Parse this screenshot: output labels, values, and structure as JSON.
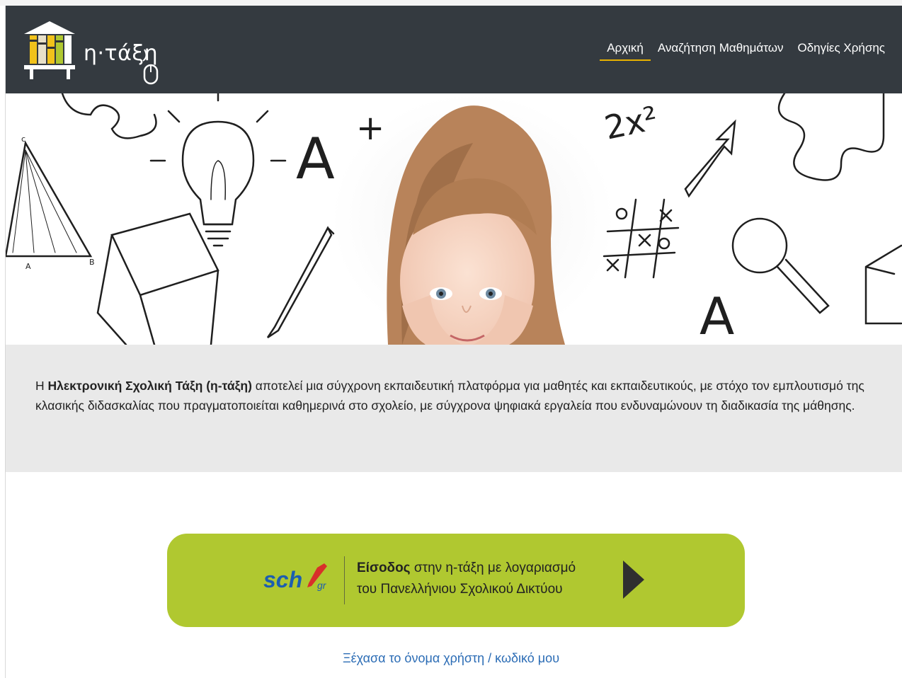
{
  "header": {
    "logo_text": "η·τάξη",
    "nav": [
      {
        "label": "Αρχική",
        "active": true
      },
      {
        "label": "Αναζήτηση Μαθημάτων",
        "active": false
      },
      {
        "label": "Οδηγίες Χρήσης",
        "active": false
      }
    ]
  },
  "hero": {
    "doodle_text_left": "A",
    "doodle_text_plus": "+",
    "doodle_equation": "2x²",
    "doodle_tictactoe": [
      "o",
      "x",
      "x",
      "o",
      "x"
    ],
    "doodle_bottom": "A",
    "triangle_labels": [
      "c",
      "A",
      "B"
    ]
  },
  "intro": {
    "prefix": "Η ",
    "bold": "Ηλεκτρονική Σχολική Τάξη (η-τάξη)",
    "rest": " αποτελεί μια σύγχρονη εκπαιδευτική πλατφόρμα για μαθητές και εκπαιδευτικούς, με στόχο τον εμπλουτισμό της κλασικής διδασκαλίας που πραγματοποιείται καθημερινά στο σχολείο, με σύγχρονα ψηφιακά εργαλεία που ενδυναμώνουν τη διαδικασία της μάθησης."
  },
  "login": {
    "logo_text": "sch",
    "logo_sub": "gr",
    "bold": "Είσοδος",
    "line1_rest": " στην η-τάξη με λογαριασμό",
    "line2": "του Πανελλήνιου Σχολικού Δικτύου"
  },
  "forgot_link": "Ξέχασα το όνομα χρήστη / κωδικό μου",
  "colors": {
    "navbar": "#343a40",
    "nav_active_underline": "#e8b100",
    "intro_background": "#e9e9e9",
    "login_button": "#b0c830",
    "link": "#2b6cb5",
    "sch_logo_blue": "#1c5eb0",
    "sch_pen_red": "#d8302a"
  }
}
